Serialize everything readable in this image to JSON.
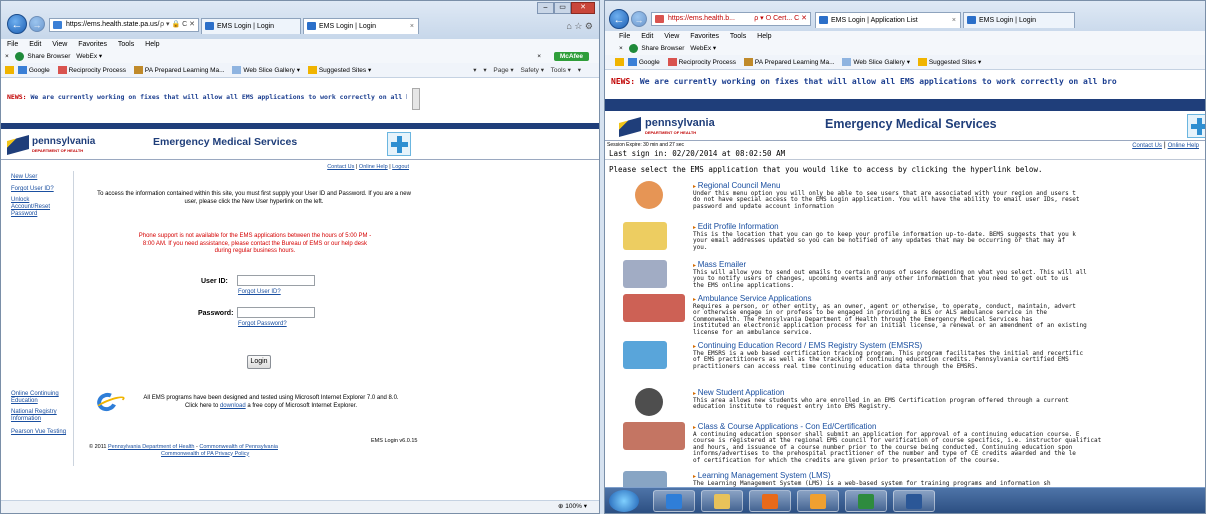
{
  "left_window": {
    "window_controls": [
      "–",
      "▭",
      "✕"
    ],
    "nav": {
      "back": "←",
      "forward": "→"
    },
    "address": "https://ems.health.state.pa.us/",
    "address_icons": "ρ ▾ 🔒 C ✕",
    "tab_left": "EMS Login | Login",
    "tab_active": "EMS Login | Login",
    "tab_close": "×",
    "nav_right_icons": "⌂ ☆ ⚙",
    "menu": [
      "File",
      "Edit",
      "View",
      "Favorites",
      "Tools",
      "Help"
    ],
    "toolbar": {
      "close": "×",
      "share": "Share Browser",
      "webex": "WebEx ▾",
      "mcafee_close": "×",
      "mcafee": "McAfee"
    },
    "favorites": [
      "Google",
      "Reciprocity Process",
      "PA Prepared Learning Ma...",
      "Web Slice Gallery ▾",
      "Suggested Sites ▾"
    ],
    "commands": [
      "▾",
      "▾",
      "Page ▾",
      "Safety ▾",
      "Tools ▾",
      "▾"
    ],
    "news_label": "NEWS:",
    "news_text": "We are currently working on fixes that will allow all EMS applications to work correctly on all bro",
    "logo": {
      "name": "pennsylvania",
      "sub": "DEPARTMENT OF HEALTH"
    },
    "site_title": "Emergency Medical Services",
    "top_links": {
      "contact": "Contact Us",
      "help": "Online Help",
      "logout": "Logout",
      "sep": "|"
    },
    "sidebar_links": [
      "New User",
      "Forgot User ID?",
      "Unlock Account/Reset Password"
    ],
    "sidebar_bottom_links": [
      "Online Continuing Education",
      "National Registry Information",
      "Pearson Vue Testing"
    ],
    "intro": "To access the information contained within this site, you must first supply your User ID and Password. If you are a new user, please click the New User hyperlink on the left.",
    "phone_notice": "Phone support is not available for the EMS applications between the hours of 5:00 PM - 8:00 AM. If you need assistance, please contact the Bureau of EMS or our help desk during regular business hours.",
    "user_id_label": "User ID:",
    "forgot_user_id": "Forgot User ID?",
    "password_label": "Password:",
    "forgot_password": "Forgot Password?",
    "login_button": "Login",
    "ie_notice_1": "All EMS programs have been designed and tested using Microsoft Internet Explorer 7.0 and 8.0.",
    "ie_notice_2a": "Click here to",
    "ie_notice_download": "download",
    "ie_notice_2b": "a free copy of Microsoft Internet Explorer.",
    "version": "EMS Login v6.0.15",
    "footer_prefix": "© 2011",
    "footer_dept": "Pennsylvania Department of Health",
    "footer_sep": " - ",
    "footer_comm": "Commonwealth of Pennsylvania",
    "footer_privacy": "Commonwealth of PA Privacy Policy",
    "zoom": "100%"
  },
  "right_window": {
    "nav": {
      "back": "←",
      "forward": "→"
    },
    "address": "https://ems.health.b...",
    "address_icons": "ρ ▾ ⭘ Cert... C ✕",
    "tab_active": "EMS Login | Application List",
    "tab_close": "×",
    "tab_second": "EMS Login | Login",
    "menu": [
      "File",
      "Edit",
      "View",
      "Favorites",
      "Tools",
      "Help"
    ],
    "toolbar": {
      "close": "×",
      "share": "Share Browser",
      "webex": "WebEx ▾"
    },
    "favorites": [
      "Google",
      "Reciprocity Process",
      "PA Prepared Learning Ma...",
      "Web Slice Gallery ▾",
      "Suggested Sites ▾"
    ],
    "news_label": "NEWS:",
    "news_text": "We are currently working on fixes that will allow all EMS applications to work correctly on all bro",
    "logo": {
      "name": "pennsylvania",
      "sub": "DEPARTMENT OF HEALTH"
    },
    "site_title": "Emergency Medical Services",
    "session": "Session Expire: 30 min and 27 sec",
    "last_sign_in": "Last sign in: 02/20/2014 at 08:02:50 AM",
    "top_links": {
      "contact": "Contact Us",
      "help": "Online Help",
      "sep": "|"
    },
    "select_prompt": "Please select the EMS application that you would like to access by clicking the hyperlink below.",
    "apps": [
      {
        "title": "Regional Council Menu",
        "icon": "people-icon",
        "color": "#e07a2a",
        "desc": [
          "Under this menu option you will only be able to see users that are associated with your region and users t",
          "do not have special access to the EMS Login application. You will have the ability to email user IDs, reset",
          "password and update account information"
        ]
      },
      {
        "title": "Edit Profile Information",
        "icon": "pencil-icon",
        "color": "#e9c13a",
        "desc": [
          "This is the location that you can go to keep your profile information up-to-date. BEMS suggests that you k",
          "your email addresses updated so you can be notified of any updates that may be occurring or that may af",
          "you."
        ]
      },
      {
        "title": "Mass Emailer",
        "icon": "envelope-icon",
        "color": "#8a97b5",
        "desc": [
          "This will allow you to send out emails to certain groups of users depending on what you select. This will all",
          "you to notify users of changes, upcoming events and any other information that you need to get out to us",
          "the EMS online applications."
        ]
      },
      {
        "title": "Ambulance Service Applications",
        "icon": "ambulance-icon",
        "color": "#c0392b",
        "desc": [
          "Requires a person, or other entity, as an owner, agent or otherwise, to operate, conduct, maintain, advert",
          "or otherwise engage in or profess to be engaged in providing a BLS or ALS ambulance service in the",
          "Commonwealth. The Pennsylvania Department of Health through the Emergency Medical Services has",
          "instituted an electronic application process for an initial license, a renewal or an amendment of an existing",
          "license for an ambulance service."
        ]
      },
      {
        "title": "Continuing Education Record / EMS Registry System (EMSRS)",
        "icon": "star-of-life-icon",
        "color": "#2f8fd1",
        "desc": [
          "The EMSRS is a web based certification tracking program. This program facilitates the initial and recertific",
          "of EMS practitioners as well as the tracking of continuing education credits. Pennsylvania certified EMS",
          "practitioners can access real time continuing education data through the EMSRS."
        ]
      },
      {
        "title": "New Student Application",
        "icon": "graduate-icon",
        "color": "#222222",
        "desc": [
          "This area allows new students who are enrolled in an EMS Certification program offered through a current",
          "education institute to request entry into EMS Registry."
        ]
      },
      {
        "title": "Class & Course Applications - Con Ed/Certification",
        "icon": "building-icon",
        "color": "#b5533c",
        "desc": [
          "A continuing education sponsor shall submit an application for approval of a continuing education course. E",
          "course is registered at the regional EMS council for verification of course specifics, i.e. instructor qualificat",
          "and hours, and issuance of a course number prior to the course being conducted. Continuing education spon",
          "informs/advertises to the prehospital practitioner of the number and type of CE credits awarded and the le",
          "of certification for which the credits are given prior to presentation of the course."
        ]
      },
      {
        "title": "Learning Management System (LMS)",
        "icon": "lms-icon",
        "color": "#6a8fb5",
        "desc": [
          "The Learning Management System (LMS) is a web-based system for training programs and information sh"
        ]
      }
    ]
  },
  "taskbar": {
    "items": [
      "ie-icon",
      "explorer-icon",
      "media-icon",
      "outlook-icon",
      "excel-icon",
      "word-icon"
    ],
    "colors": [
      "#2f7ed8",
      "#e8c25a",
      "#e86a1a",
      "#f0a030",
      "#2e8b3e",
      "#2b5797"
    ]
  },
  "colors": {
    "news": "#1a3d8f",
    "news_label": "#c00000",
    "pa_blue": "#1f3e7a",
    "link": "#1a4fa0",
    "alert": "#d40000"
  }
}
